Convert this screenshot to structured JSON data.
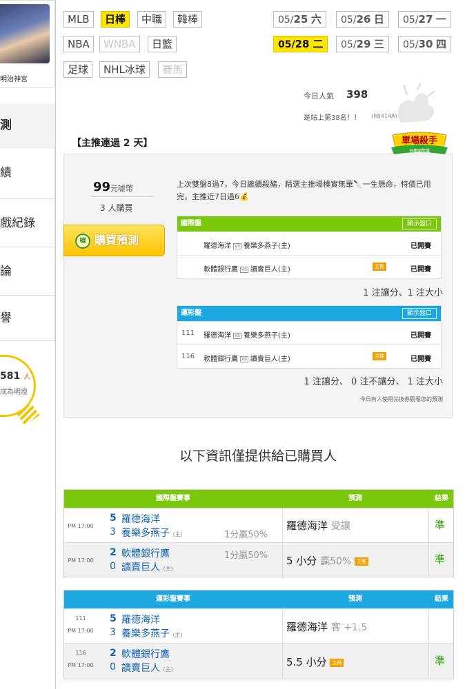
{
  "sidebar": {
    "user_name": "明治神宮",
    "menu": [
      "測",
      "績",
      "戲紀錄",
      "論",
      "譽"
    ],
    "bulb_count": "581",
    "bulb_unit": "人",
    "bulb_sub": "成為明燈"
  },
  "nav": {
    "sports": [
      {
        "label": "MLB",
        "state": "normal"
      },
      {
        "label": "日棒",
        "state": "active"
      },
      {
        "label": "中職",
        "state": "normal"
      },
      {
        "label": "韓棒",
        "state": "normal"
      },
      {
        "label": "NBA",
        "state": "normal"
      },
      {
        "label": "WNBA",
        "state": "disabled"
      },
      {
        "label": "日籃",
        "state": "normal"
      },
      {
        "label": "足球",
        "state": "normal"
      },
      {
        "label": "NHL冰球",
        "state": "normal"
      },
      {
        "label": "賽馬",
        "state": "disabled"
      }
    ],
    "dates": [
      {
        "md": "05/",
        "d": "25",
        "w": "六",
        "active": false
      },
      {
        "md": "05/",
        "d": "26",
        "w": "日",
        "active": false
      },
      {
        "md": "05/",
        "d": "27",
        "w": "一",
        "active": false
      },
      {
        "md": "05/",
        "d": "28",
        "w": "二",
        "active": true
      },
      {
        "md": "05/",
        "d": "29",
        "w": "三",
        "active": false
      },
      {
        "md": "05/",
        "d": "30",
        "w": "四",
        "active": false
      }
    ]
  },
  "stats": {
    "popularity_label": "今日人氣",
    "popularity_value": "398",
    "rank_text": "是站上第38名！！",
    "rank_code": "(R8414A)"
  },
  "card": {
    "title": "【主推連過 2 天】",
    "badge_top": "單場殺手",
    "badge_bottom": "日棒國際盤",
    "price": "99",
    "price_unit": "元嘘幣",
    "buyers": "3 人購買",
    "buy_label": "購買預測",
    "coin_label": "嘘",
    "analysis": "上次雙盤8過7，今日繼續殺豬，精選主推場樸實無華🔪一生懸命，特價已用完，主推近7日過6💰",
    "intl": {
      "title": "國際盤",
      "show": "顯示盤口",
      "rows": [
        {
          "away": "羅德海洋",
          "home": "養樂多燕子(主)",
          "tag": "",
          "status": "已開賽"
        },
        {
          "away": "軟體銀行鷹",
          "home": "讀賣巨人(主)",
          "tag": "主推",
          "status": "已開賽"
        }
      ],
      "summary": "1 注讓分、1 注大小"
    },
    "lottery": {
      "title": "運彩盤",
      "show": "顯示盤口",
      "rows": [
        {
          "no": "111",
          "away": "羅德海洋",
          "home": "養樂多燕子(主)",
          "tag": "",
          "status": "已開賽"
        },
        {
          "no": "116",
          "away": "軟體銀行鷹",
          "home": "讀賣巨人(主)",
          "tag": "主推",
          "status": "已開賽"
        }
      ],
      "summary": "1 注讓分、 0 注不讓分、 1 注大小",
      "voucher_note": "今日有人使用兌換券觀看您的預測"
    },
    "vs": "VS"
  },
  "info_note": "以下資訊僅提供給已購買人",
  "results_intl": {
    "head_match": "國際盤賽事",
    "head_pred": "預測",
    "head_res": "結果",
    "rows": [
      {
        "no": "",
        "time": "PM 17:00",
        "s1": "5",
        "s2": "3",
        "t1": "羅德海洋",
        "t2": "養樂多燕子",
        "host": "(主)",
        "odds": "1分贏50%",
        "odds_row": 2,
        "pred": "羅德海洋",
        "pred_sub": "受讓",
        "hm": "",
        "result": "準"
      },
      {
        "no": "",
        "time": "PM 17:00",
        "s1": "2",
        "s2": "0",
        "t1": "軟體銀行鷹",
        "t2": "讀賣巨人",
        "host": "(主)",
        "odds": "1分贏50%",
        "odds_row": 1,
        "pred": "5 小分",
        "pred_sub": "贏50%",
        "hm": "主推",
        "result": "準"
      }
    ]
  },
  "results_lottery": {
    "head_match": "運彩盤賽事",
    "head_pred": "預測",
    "head_res": "結果",
    "rows": [
      {
        "no": "111",
        "time": "PM 17:00",
        "s1": "5",
        "s2": "3",
        "t1": "羅德海洋",
        "t2": "養樂多燕子",
        "host": "(主)",
        "odds": "",
        "odds_row": 0,
        "pred": "羅德海洋",
        "pred_sub": "客 +1.5",
        "hm": "",
        "result": ""
      },
      {
        "no": "116",
        "time": "PM 17:00",
        "s1": "2",
        "s2": "0",
        "t1": "軟體銀行鷹",
        "t2": "讀賣巨人",
        "host": "(主)",
        "odds": "",
        "odds_row": 0,
        "pred": "5.5 小分",
        "pred_sub": "",
        "hm": "主推",
        "result": "準"
      }
    ]
  },
  "colors": {
    "green_head": "#7ac70c",
    "blue_head": "#1da7e0",
    "accent_yellow": "#ffe600",
    "win_green": "#26a100",
    "team_blue": "#1464b4"
  }
}
